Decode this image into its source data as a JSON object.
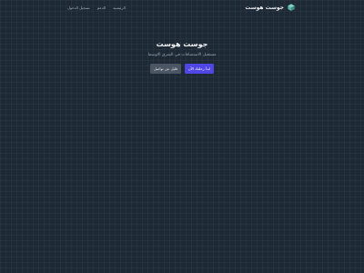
{
  "header": {
    "brand_name": "جوست هوست",
    "brand_icon": "cube-logo-icon",
    "nav": [
      {
        "label": "الرئيسية"
      },
      {
        "label": "الدعم"
      },
      {
        "label": "تسجيل الدخول"
      }
    ]
  },
  "hero": {
    "title": "جوست هوست",
    "subtitle": "مستقبل الاستضافات في الشرق الاوسط",
    "secondary_button": "قليل عن تواصل",
    "primary_button": "ابدأ رحلتك الآن"
  },
  "colors": {
    "background": "#1e2936",
    "primary": "#4f46e5",
    "secondary": "#4b5563",
    "logo": "#5fb3a7"
  }
}
